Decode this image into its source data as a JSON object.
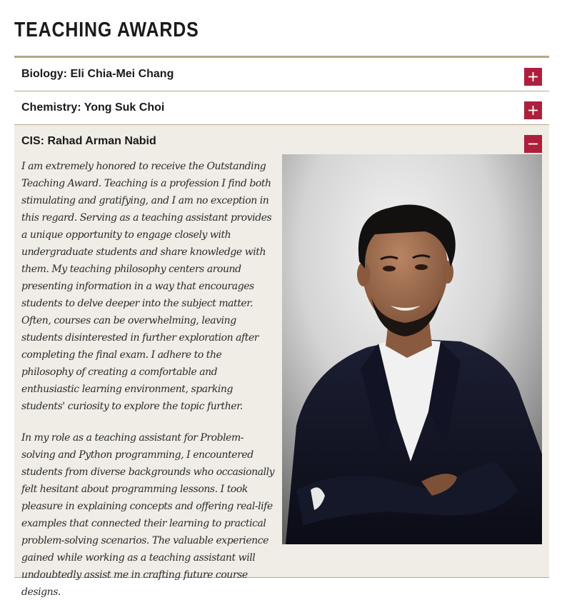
{
  "page": {
    "title": "TEACHING AWARDS"
  },
  "accordion": {
    "items": [
      {
        "title": "Biology: Eli Chia-Mei Chang",
        "toggle_icon": "plus-icon",
        "expanded": false
      },
      {
        "title": "Chemistry: Yong Suk Choi",
        "toggle_icon": "plus-icon",
        "expanded": false
      },
      {
        "title": "CIS: Rahad Arman Nabid",
        "toggle_icon": "minus-icon",
        "expanded": true,
        "paragraphs": [
          "I am extremely honored to receive the Outstanding Teaching Award. Teaching is a profession I find both stimulating and gratifying, and I am no exception in this regard. Serving as a teaching assistant provides a unique opportunity to engage closely with undergraduate students and share knowledge with them. My teaching philosophy centers around presenting information in a way that encourages students to delve deeper into the subject matter. Often, courses can be overwhelming, leaving students disinterested in further exploration after completing the final exam. I adhere to the philosophy of creating a comfortable and enthusiastic learning environment, sparking students' curiosity to explore the topic further.",
          "In my role as a teaching assistant for Problem-solving and Python programming, I encountered students from diverse backgrounds who occasionally felt hesitant about programming lessons. I took pleasure in explaining concepts and offering real-life examples that connected their learning to practical problem-solving scenarios. The valuable experience gained while working as a teaching assistant will undoubtedly assist me in crafting future course designs."
        ]
      }
    ]
  },
  "colors": {
    "accent": "#ad1f3c",
    "divider": "#b9a789",
    "expanded_background": "#f0ede6"
  }
}
